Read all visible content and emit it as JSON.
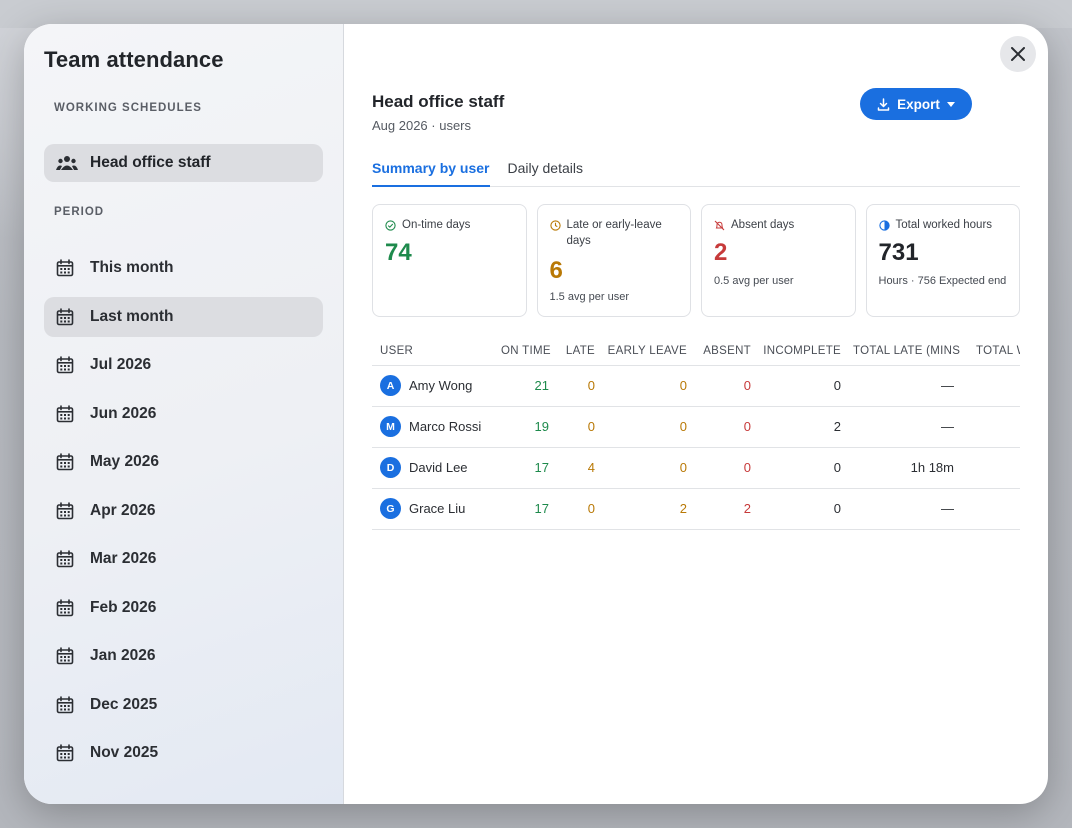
{
  "sidebar": {
    "title": "Team attendance",
    "schedules_label": "WORKING SCHEDULES",
    "schedule": "Head office staff",
    "period_label": "PERIOD",
    "periods": [
      {
        "label": "This month",
        "active": false
      },
      {
        "label": "Last month",
        "active": true
      },
      {
        "label": "Jul 2026",
        "active": false
      },
      {
        "label": "Jun 2026",
        "active": false
      },
      {
        "label": "May 2026",
        "active": false
      },
      {
        "label": "Apr 2026",
        "active": false
      },
      {
        "label": "Mar 2026",
        "active": false
      },
      {
        "label": "Feb 2026",
        "active": false
      },
      {
        "label": "Jan 2026",
        "active": false
      },
      {
        "label": "Dec 2025",
        "active": false
      },
      {
        "label": "Nov 2025",
        "active": false
      }
    ]
  },
  "header": {
    "title": "Head office staff",
    "subtitle": "Aug 2026 · users",
    "export_label": "Export"
  },
  "tabs": [
    {
      "label": "Summary by user",
      "active": true
    },
    {
      "label": "Daily details",
      "active": false
    }
  ],
  "cards": [
    {
      "label": "On-time days",
      "value": "74",
      "note": "",
      "color": "#1e8a4c",
      "icon": "check-circle-icon"
    },
    {
      "label": "Late or early-leave days",
      "value": "6",
      "note": "1.5 avg per user",
      "color": "#b97906",
      "icon": "clock-icon"
    },
    {
      "label": "Absent days",
      "value": "2",
      "note": "0.5 avg per user",
      "color": "#c73a3a",
      "icon": "bell-off-icon"
    },
    {
      "label": "Total worked hours",
      "value": "731",
      "note": "Hours · 756 Expected end",
      "color": "#22252a",
      "icon": "pie-icon"
    }
  ],
  "table": {
    "columns": [
      "USER",
      "ON TIME",
      "LATE",
      "EARLY LEAVE",
      "ABSENT",
      "INCOMPLETE",
      "TOTAL LATE (MINS)",
      "TOTAL WORKED"
    ],
    "rows": [
      {
        "initial": "A",
        "name": "Amy Wong",
        "on_time": "21",
        "late": "0",
        "early_leave": "0",
        "absent": "0",
        "incomplete": "0",
        "total_late": "—"
      },
      {
        "initial": "M",
        "name": "Marco Rossi",
        "on_time": "19",
        "late": "0",
        "early_leave": "0",
        "absent": "0",
        "incomplete": "2",
        "total_late": "—"
      },
      {
        "initial": "D",
        "name": "David Lee",
        "on_time": "17",
        "late": "4",
        "early_leave": "0",
        "absent": "0",
        "incomplete": "0",
        "total_late": "1h 18m"
      },
      {
        "initial": "G",
        "name": "Grace Liu",
        "on_time": "17",
        "late": "0",
        "early_leave": "2",
        "absent": "2",
        "incomplete": "0",
        "total_late": "—"
      }
    ]
  },
  "colors": {
    "accent": "#1a6fe0",
    "on_time": "#1e8a4c",
    "late": "#b97906",
    "absent": "#c73a3a"
  }
}
